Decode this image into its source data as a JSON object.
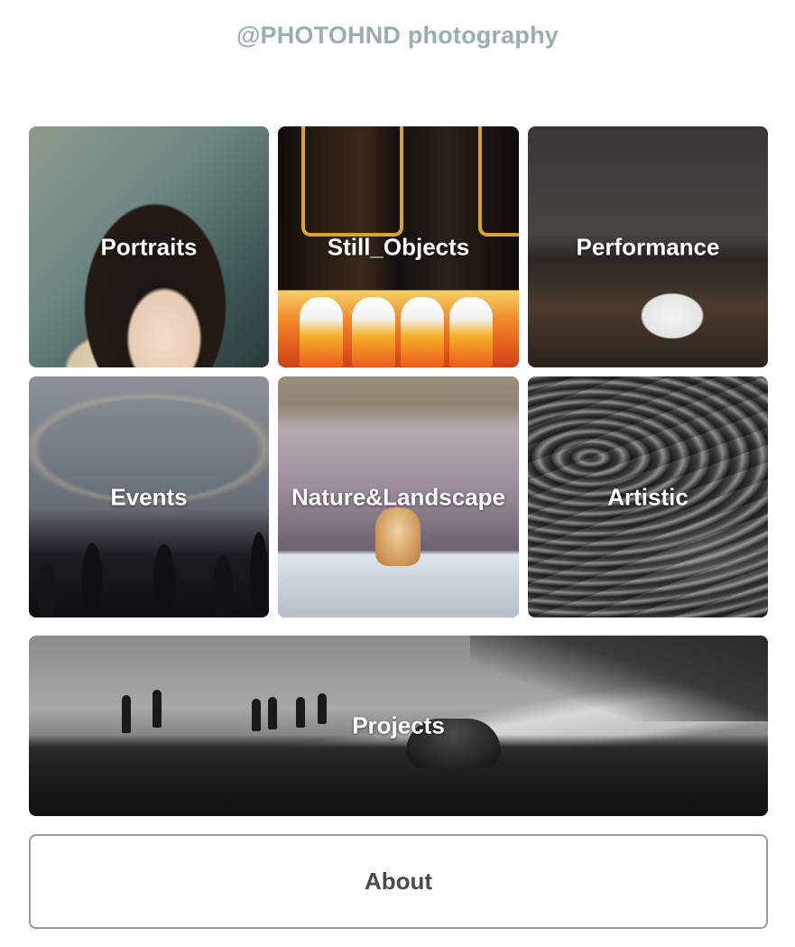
{
  "site": {
    "title": "@PHOTOHND photography"
  },
  "gallery": {
    "portraits": {
      "label": "Portraits"
    },
    "still_objects": {
      "label": "Still_Objects"
    },
    "performance": {
      "label": "Performance"
    },
    "events": {
      "label": "Events"
    },
    "nature": {
      "label": "Nature&Landscape"
    },
    "artistic": {
      "label": "Artistic"
    },
    "projects": {
      "label": "Projects"
    }
  },
  "about": {
    "label": "About"
  },
  "colors": {
    "title": "#98afb0",
    "tile_label": "#ffffff",
    "about_text": "#4a4a4a",
    "about_border": "#9a9a9a"
  }
}
